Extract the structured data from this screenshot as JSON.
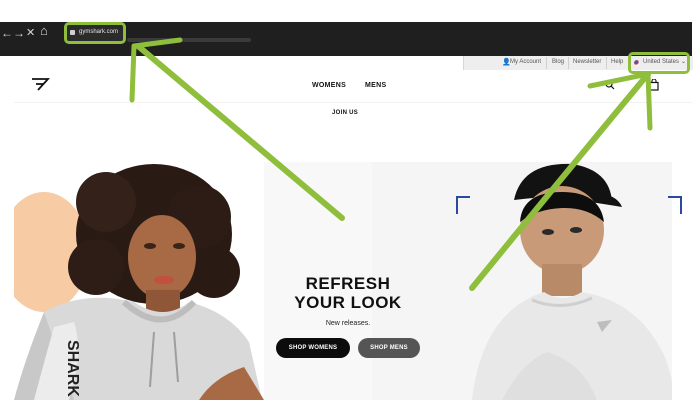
{
  "browser": {
    "nav_back": "←",
    "nav_forward": "→",
    "nav_close": "✕",
    "nav_home": "⌂",
    "url": "gymshark.com"
  },
  "utility_bar": {
    "my_account": "My Account",
    "blog": "Blog",
    "newsletter": "Newsletter",
    "help": "Help",
    "region": "United States"
  },
  "nav": {
    "womens": "WOMENS",
    "mens": "MENS",
    "join_us": "JOIN US"
  },
  "hero": {
    "headline_line1": "REFRESH",
    "headline_line2": "YOUR LOOK",
    "subtext": "New releases.",
    "shop_womens": "SHOP WOMENS",
    "shop_mens": "SHOP MENS",
    "hoodie_print": "SHARK"
  },
  "colors": {
    "highlight": "#8ebe3b",
    "browser_dark": "#1f1f1f",
    "button_dark": "#0c0c0c",
    "button_grey": "#555555",
    "bracket_blue": "#2a4a9c"
  }
}
